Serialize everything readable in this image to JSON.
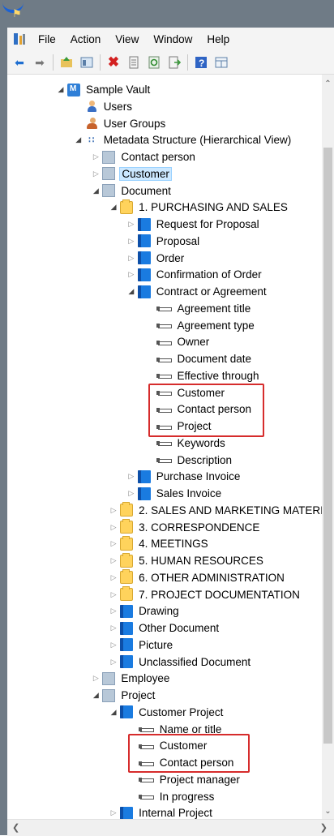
{
  "menu": [
    "File",
    "Action",
    "View",
    "Window",
    "Help"
  ],
  "toolbar_icons": [
    "back-icon",
    "forward-icon",
    "up-folder-icon",
    "view-icon",
    "delete-icon",
    "properties-icon",
    "refresh-icon",
    "export-icon",
    "help-icon",
    "panel-icon"
  ],
  "tree": [
    {
      "label": "Sample Vault",
      "level": 3,
      "icon": "vault",
      "expander": "open"
    },
    {
      "label": "Users",
      "level": 4,
      "icon": "user",
      "expander": "none"
    },
    {
      "label": "User Groups",
      "level": 4,
      "icon": "users",
      "expander": "none"
    },
    {
      "label": "Metadata Structure (Hierarchical View)",
      "level": 4,
      "icon": "meta",
      "expander": "open"
    },
    {
      "label": "Contact person",
      "level": 5,
      "icon": "otype",
      "expander": "closed"
    },
    {
      "label": "Customer",
      "level": 5,
      "icon": "otype",
      "expander": "closed",
      "selected": true
    },
    {
      "label": "Document",
      "level": 5,
      "icon": "otype",
      "expander": "open"
    },
    {
      "label": "1. PURCHASING AND SALES",
      "level": 6,
      "icon": "folder",
      "expander": "open"
    },
    {
      "label": "Request for Proposal",
      "level": 7,
      "icon": "doc",
      "expander": "closed"
    },
    {
      "label": "Proposal",
      "level": 7,
      "icon": "doc",
      "expander": "closed"
    },
    {
      "label": "Order",
      "level": 7,
      "icon": "doc",
      "expander": "closed"
    },
    {
      "label": "Confirmation of Order",
      "level": 7,
      "icon": "doc",
      "expander": "closed"
    },
    {
      "label": "Contract or Agreement",
      "level": 7,
      "icon": "doc",
      "expander": "open"
    },
    {
      "label": "Agreement title",
      "level": 8,
      "icon": "prop",
      "expander": "none"
    },
    {
      "label": "Agreement type",
      "level": 8,
      "icon": "prop",
      "expander": "none"
    },
    {
      "label": "Owner",
      "level": 8,
      "icon": "prop",
      "expander": "none"
    },
    {
      "label": "Document date",
      "level": 8,
      "icon": "prop",
      "expander": "none"
    },
    {
      "label": "Effective through",
      "level": 8,
      "icon": "prop",
      "expander": "none"
    },
    {
      "label": "Customer",
      "level": 8,
      "icon": "prop",
      "expander": "none"
    },
    {
      "label": "Contact person",
      "level": 8,
      "icon": "prop",
      "expander": "none"
    },
    {
      "label": "Project",
      "level": 8,
      "icon": "prop",
      "expander": "none"
    },
    {
      "label": "Keywords",
      "level": 8,
      "icon": "prop",
      "expander": "none"
    },
    {
      "label": "Description",
      "level": 8,
      "icon": "prop",
      "expander": "none"
    },
    {
      "label": "Purchase Invoice",
      "level": 7,
      "icon": "doc",
      "expander": "closed"
    },
    {
      "label": "Sales Invoice",
      "level": 7,
      "icon": "doc",
      "expander": "closed"
    },
    {
      "label": "2. SALES AND MARKETING MATERI",
      "level": 6,
      "icon": "folder",
      "expander": "closed"
    },
    {
      "label": "3. CORRESPONDENCE",
      "level": 6,
      "icon": "folder",
      "expander": "closed"
    },
    {
      "label": "4. MEETINGS",
      "level": 6,
      "icon": "folder",
      "expander": "closed"
    },
    {
      "label": "5. HUMAN RESOURCES",
      "level": 6,
      "icon": "folder",
      "expander": "closed"
    },
    {
      "label": "6. OTHER ADMINISTRATION",
      "level": 6,
      "icon": "folder",
      "expander": "closed"
    },
    {
      "label": "7. PROJECT DOCUMENTATION",
      "level": 6,
      "icon": "folder",
      "expander": "closed"
    },
    {
      "label": "Drawing",
      "level": 6,
      "icon": "doc",
      "expander": "closed"
    },
    {
      "label": "Other Document",
      "level": 6,
      "icon": "doc",
      "expander": "closed"
    },
    {
      "label": "Picture",
      "level": 6,
      "icon": "doc",
      "expander": "closed"
    },
    {
      "label": "Unclassified Document",
      "level": 6,
      "icon": "doc",
      "expander": "closed"
    },
    {
      "label": "Employee",
      "level": 5,
      "icon": "otype",
      "expander": "closed"
    },
    {
      "label": "Project",
      "level": 5,
      "icon": "otype",
      "expander": "open"
    },
    {
      "label": "Customer Project",
      "level": 6,
      "icon": "doc",
      "expander": "open"
    },
    {
      "label": "Name or title",
      "level": 7,
      "icon": "prop",
      "expander": "none"
    },
    {
      "label": "Customer",
      "level": 7,
      "icon": "prop",
      "expander": "none"
    },
    {
      "label": "Contact person",
      "level": 7,
      "icon": "prop",
      "expander": "none"
    },
    {
      "label": "Project manager",
      "level": 7,
      "icon": "prop",
      "expander": "none"
    },
    {
      "label": "In progress",
      "level": 7,
      "icon": "prop",
      "expander": "none"
    },
    {
      "label": "Internal Project",
      "level": 6,
      "icon": "doc",
      "expander": "closed"
    }
  ],
  "colors": {
    "highlight_border": "#d62c2c",
    "selection_bg": "#cce8ff",
    "frame": "#6f7b86"
  }
}
